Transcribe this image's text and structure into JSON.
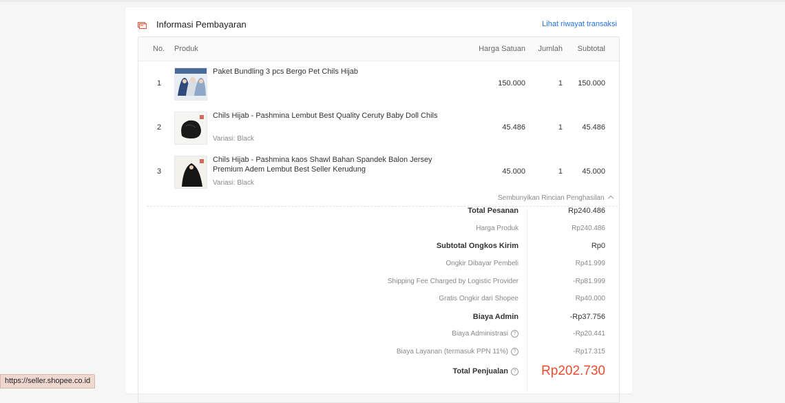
{
  "header": {
    "title": "Informasi Pembayaran",
    "history_link": "Lihat riwayat transaksi"
  },
  "table": {
    "columns": {
      "no": "No.",
      "product": "Produk",
      "unit_price": "Harga Satuan",
      "qty": "Jumlah",
      "subtotal": "Subtotal"
    },
    "rows": [
      {
        "no": "1",
        "name": "Paket Bundling 3 pcs Bergo Pet Chils Hijab",
        "variant": "",
        "price": "150.000",
        "qty": "1",
        "subtotal": "150.000"
      },
      {
        "no": "2",
        "name": "Chils Hijab - Pashmina Lembut Best Quality Ceruty Baby Doll Chils",
        "variant": "Variasi: Black",
        "price": "45.486",
        "qty": "1",
        "subtotal": "45.486"
      },
      {
        "no": "3",
        "name": "Chils Hijab - Pashmina kaos Shawl Bahan Spandek Balon Jersey Premium Adem Lembut Best Seller Kerudung",
        "variant": "Variasi: Black",
        "price": "45.000",
        "qty": "1",
        "subtotal": "45.000"
      }
    ]
  },
  "summary": {
    "toggle_label": "Sembunyikan Rincian Penghasilan",
    "total_pesanan": {
      "label": "Total Pesanan",
      "value": "Rp240.486"
    },
    "harga_produk": {
      "label": "Harga Produk",
      "value": "Rp240.486"
    },
    "subtotal_ongkir": {
      "label": "Subtotal Ongkos Kirim",
      "value": "Rp0"
    },
    "ongkir_pembeli": {
      "label": "Ongkir Dibayar Pembeli",
      "value": "Rp41.999"
    },
    "shipping_fee": {
      "label": "Shipping Fee Charged by Logistic Provider",
      "value": "-Rp81.999"
    },
    "gratis_ongkir": {
      "label": "Gratis Ongkir dari Shopee",
      "value": "Rp40.000"
    },
    "biaya_admin": {
      "label": "Biaya Admin",
      "value": "-Rp37.756"
    },
    "biaya_administrasi": {
      "label": "Biaya Administrasi",
      "value": "-Rp20.441"
    },
    "biaya_layanan": {
      "label": "Biaya Layanan (termasuk PPN 11%)",
      "value": "-Rp17.315"
    },
    "total_penjualan": {
      "label": "Total Penjualan",
      "value": "Rp202.730"
    }
  },
  "status_bar": {
    "url": "https://seller.shopee.co.id"
  },
  "colors": {
    "accent": "#ee4d2d",
    "link": "#2673dd"
  }
}
